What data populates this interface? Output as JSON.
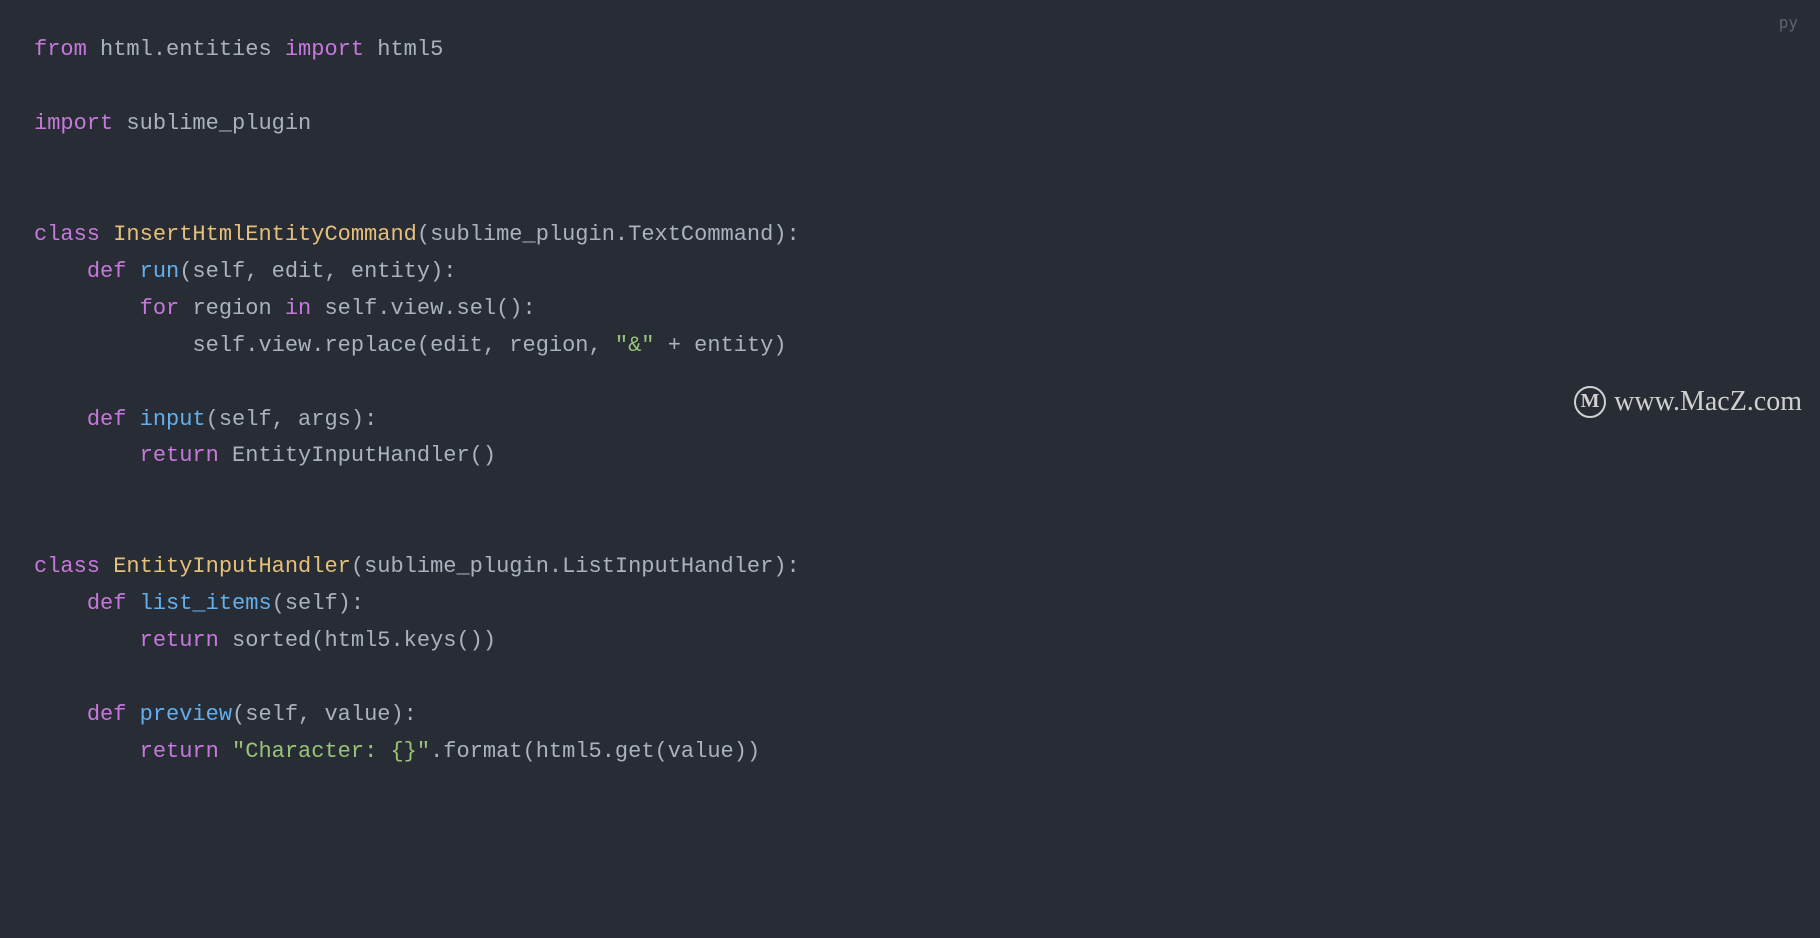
{
  "language_label": "py",
  "watermark": {
    "icon_letter": "M",
    "text": "www.MacZ.com"
  },
  "code": {
    "line1": {
      "kw_from": "from",
      "module": "html.entities",
      "kw_import": "import",
      "name": "html5"
    },
    "line3": {
      "kw_import": "import",
      "name": "sublime_plugin"
    },
    "line6": {
      "kw_class": "class",
      "class_name": "InsertHtmlEntityCommand",
      "paren_open": "(",
      "base": "sublime_plugin.TextCommand",
      "paren_close": "):"
    },
    "line7": {
      "indent": "    ",
      "kw_def": "def",
      "func_name": "run",
      "params": "(self, edit, entity):"
    },
    "line8": {
      "indent": "        ",
      "kw_for": "for",
      "var": "region",
      "kw_in": "in",
      "expr": "self.view.sel():"
    },
    "line9": {
      "indent": "            ",
      "expr_pre": "self.view.replace(edit, region, ",
      "string": "\"&\"",
      "expr_post": " + entity)"
    },
    "line11": {
      "indent": "    ",
      "kw_def": "def",
      "func_name": "input",
      "params": "(self, args):"
    },
    "line12": {
      "indent": "        ",
      "kw_return": "return",
      "expr": "EntityInputHandler()"
    },
    "line15": {
      "kw_class": "class",
      "class_name": "EntityInputHandler",
      "paren_open": "(",
      "base": "sublime_plugin.ListInputHandler",
      "paren_close": "):"
    },
    "line16": {
      "indent": "    ",
      "kw_def": "def",
      "func_name": "list_items",
      "params": "(self):"
    },
    "line17": {
      "indent": "        ",
      "kw_return": "return",
      "expr": "sorted(html5.keys())"
    },
    "line19": {
      "indent": "    ",
      "kw_def": "def",
      "func_name": "preview",
      "params": "(self, value):"
    },
    "line20": {
      "indent": "        ",
      "kw_return": "return",
      "string": "\"Character: {}\"",
      "expr": ".format(html5.get(value))"
    }
  }
}
